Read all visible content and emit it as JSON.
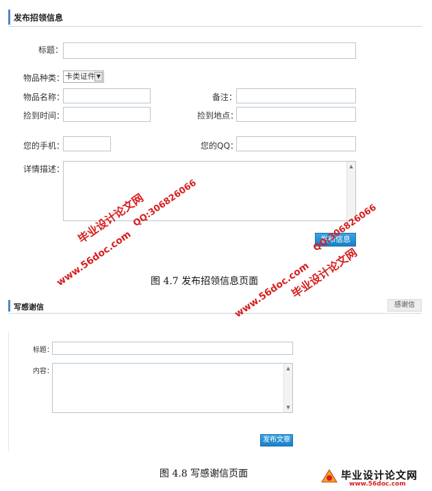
{
  "section1": {
    "title": "发布招领信息",
    "fields": {
      "title_label": "标题：",
      "category_label": "物品种类：",
      "category_value": "卡类证件",
      "item_name_label": "物品名称：",
      "note_label": "备注：",
      "found_time_label": "捡到时间：",
      "found_place_label": "捡到地点：",
      "phone_label": "您的手机：",
      "qq_label": "您的QQ：",
      "detail_label": "详情描述："
    },
    "submit_label": "发布信息",
    "caption": "图 4.7 发布招领信息页面"
  },
  "section2": {
    "title": "写感谢信",
    "tab_label": "感谢信",
    "title_label": "标题：",
    "content_label": "内容：",
    "submit_label": "发布文章",
    "caption": "图 4.8 写感谢信页面"
  },
  "watermarks": {
    "site_cn": "毕业设计论文网",
    "qq": "QQ:306826066",
    "url": "www.56doc.com",
    "brand_url": "www.56doc.com"
  },
  "colors": {
    "accent": "#4a86c5",
    "button": "#1b7fc4",
    "watermark": "#d81e1e"
  }
}
